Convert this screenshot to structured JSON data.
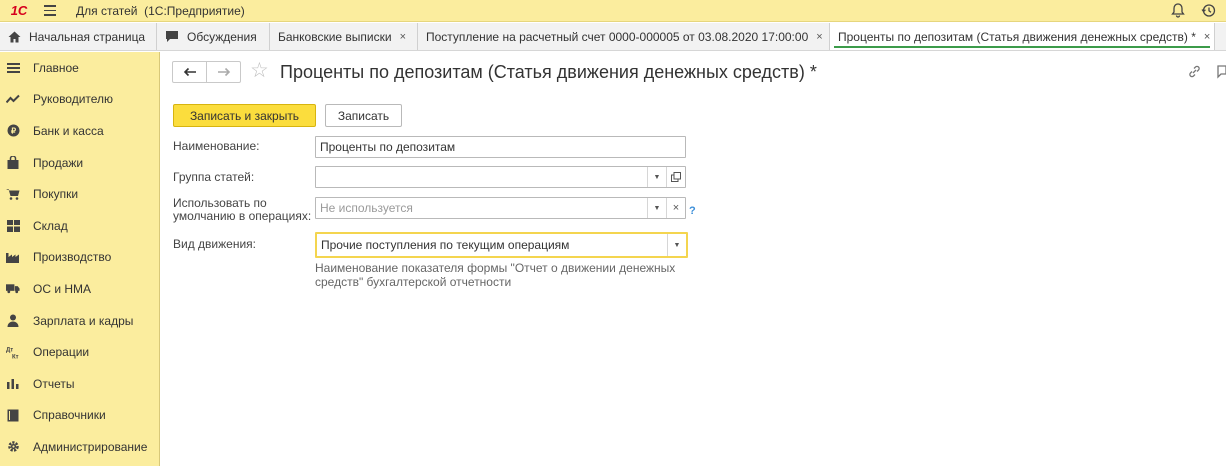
{
  "app": {
    "logo_text": "1С",
    "title": "Для статей  (1С:Предприятие)"
  },
  "tabs": [
    {
      "label": "Начальная страница",
      "icon": "home-icon",
      "closable": false,
      "active": false
    },
    {
      "label": "Обсуждения",
      "icon": "chat-icon",
      "closable": false,
      "active": false
    },
    {
      "label": "Банковские выписки",
      "closable": true,
      "active": false
    },
    {
      "label": "Поступление на расчетный счет 0000-000005 от 03.08.2020 17:00:00",
      "closable": true,
      "active": false
    },
    {
      "label": "Проценты по депозитам (Статья движения денежных средств) *",
      "closable": true,
      "active": true
    }
  ],
  "tab_close_glyph": "×",
  "sidebar": {
    "items": [
      {
        "label": "Главное",
        "icon": "menu-lines-icon"
      },
      {
        "label": "Руководителю",
        "icon": "trend-chart-icon"
      },
      {
        "label": "Банк и касса",
        "icon": "coin-icon"
      },
      {
        "label": "Продажи",
        "icon": "shopping-bag-icon"
      },
      {
        "label": "Покупки",
        "icon": "cart-icon"
      },
      {
        "label": "Склад",
        "icon": "warehouse-icon"
      },
      {
        "label": "Производство",
        "icon": "factory-icon"
      },
      {
        "label": "ОС и НМА",
        "icon": "truck-icon"
      },
      {
        "label": "Зарплата и кадры",
        "icon": "person-icon"
      },
      {
        "label": "Операции",
        "icon": "dt-kt-icon"
      },
      {
        "label": "Отчеты",
        "icon": "bar-chart-icon"
      },
      {
        "label": "Справочники",
        "icon": "book-icon"
      },
      {
        "label": "Администрирование",
        "icon": "gear-icon"
      }
    ]
  },
  "form": {
    "title": "Проценты по депозитам (Статья движения денежных средств) *",
    "back_glyph": "🡐",
    "forward_glyph": "🡒",
    "star_glyph": "☆",
    "save_close_label": "Записать и закрыть",
    "save_label": "Записать",
    "fields": {
      "name": {
        "label": "Наименование:",
        "value": "Проценты по депозитам"
      },
      "group": {
        "label": "Группа статей:",
        "value": ""
      },
      "default_use": {
        "label_line1": "Использовать по",
        "label_line2": "умолчанию в операциях:",
        "placeholder": "Не используется"
      },
      "movement_type": {
        "label": "Вид движения:",
        "value": "Прочие поступления по текущим операциям"
      }
    },
    "help_glyph": "?",
    "clear_glyph": "×",
    "hint": "Наименование показателя формы \"Отчет о движении денежных средств\" бухгалтерской отчетности"
  },
  "colors": {
    "sidebar_bg": "#fbed9e",
    "primary_button": "#fbdd3d",
    "active_tab_underline": "#3c9b4a",
    "logo": "#d6001c",
    "help": "#3b8ed8"
  }
}
